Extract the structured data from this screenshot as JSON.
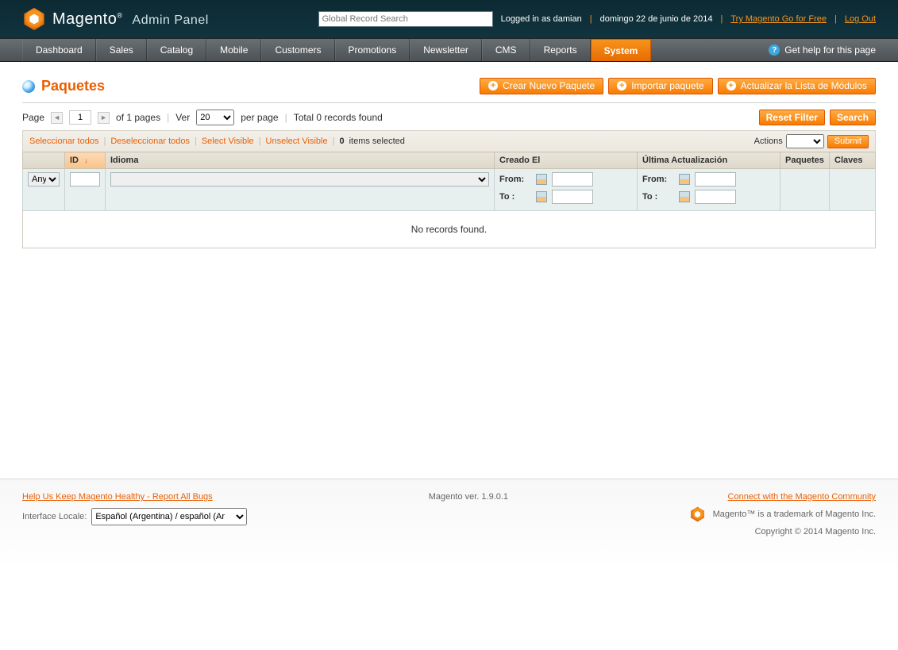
{
  "header": {
    "brand": "Magento",
    "subtitle": "Admin Panel",
    "search_placeholder": "Global Record Search",
    "logged_in_prefix": "Logged in as",
    "user": "damian",
    "date": "domingo 22 de junio de 2014",
    "try_link": "Try Magento Go for Free",
    "logout": "Log Out"
  },
  "nav": {
    "items": [
      "Dashboard",
      "Sales",
      "Catalog",
      "Mobile",
      "Customers",
      "Promotions",
      "Newsletter",
      "CMS",
      "Reports",
      "System"
    ],
    "active": "System",
    "help": "Get help for this page"
  },
  "page": {
    "title": "Paquetes",
    "buttons": {
      "create": "Crear Nuevo Paquete",
      "import": "Importar paquete",
      "refresh": "Actualizar la Lista de Módulos"
    }
  },
  "pager": {
    "page_label": "Page",
    "page_value": "1",
    "total_pages_text": "of 1 pages",
    "view_label": "Ver",
    "per_page_value": "20",
    "per_page_label": "per page",
    "total_text": "Total 0 records found",
    "reset": "Reset Filter",
    "search": "Search"
  },
  "mass": {
    "select_all": "Seleccionar todos",
    "unselect_all": "Deseleccionar todos",
    "select_visible": "Select Visible",
    "unselect_visible": "Unselect Visible",
    "items_selected_count": "0",
    "items_selected_label": "items selected",
    "actions_label": "Actions",
    "submit": "Submit"
  },
  "columns": {
    "id": "ID",
    "idioma": "Idioma",
    "creado": "Creado El",
    "actualizacion": "Última Actualización",
    "paquetes": "Paquetes",
    "claves": "Claves"
  },
  "filters": {
    "any_option": "Any",
    "from_label": "From:",
    "to_label": "To :"
  },
  "grid": {
    "no_records": "No records found."
  },
  "footer": {
    "report_bugs": "Help Us Keep Magento Healthy - Report All Bugs",
    "locale_label": "Interface Locale:",
    "locale_value": "Español (Argentina) / español (Ar",
    "version": "Magento ver. 1.9.0.1",
    "community": "Connect with the Magento Community",
    "trademark": "Magento™ is a trademark of Magento Inc.",
    "copyright": "Copyright © 2014 Magento Inc."
  }
}
